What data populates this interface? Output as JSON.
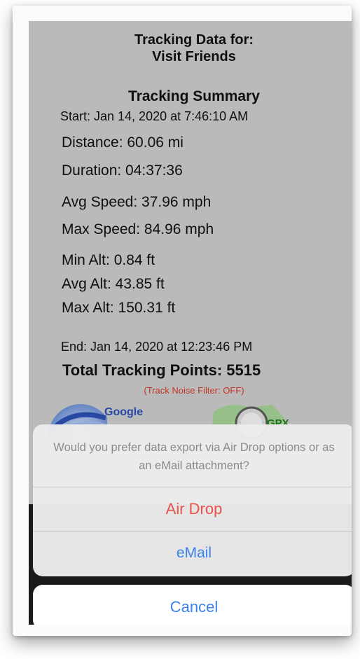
{
  "report": {
    "title_line1": "Tracking Data for:",
    "title_line2": "Visit Friends",
    "summary_heading": "Tracking Summary",
    "start": "Start: Jan 14, 2020 at 7:46:10 AM",
    "distance": "Distance:  60.06 mi",
    "duration": "Duration: 04:37:36",
    "avg_speed": "Avg Speed:  37.96 mph",
    "max_speed": "Max Speed:  84.96 mph",
    "min_alt": "Min Alt:   0.84 ft",
    "avg_alt": "Avg Alt:  43.85 ft",
    "max_alt": "Max Alt: 150.31 ft",
    "end": "End: Jan 14, 2020 at 12:23:46 PM",
    "total_points": "Total Tracking Points: 5515",
    "noise_filter": "(Track Noise Filter: OFF)"
  },
  "export_logos": {
    "google_label": "Google",
    "gpx_label": "GPX"
  },
  "action_sheet": {
    "message": "Would you prefer data export via Air Drop options or as an eMail attachment?",
    "airdrop_label": "Air Drop",
    "email_label": "eMail",
    "cancel_label": "Cancel"
  },
  "colors": {
    "destructive_red": "#e8524a",
    "ios_blue": "#3b82e8",
    "noise_red": "#d23a2a"
  }
}
